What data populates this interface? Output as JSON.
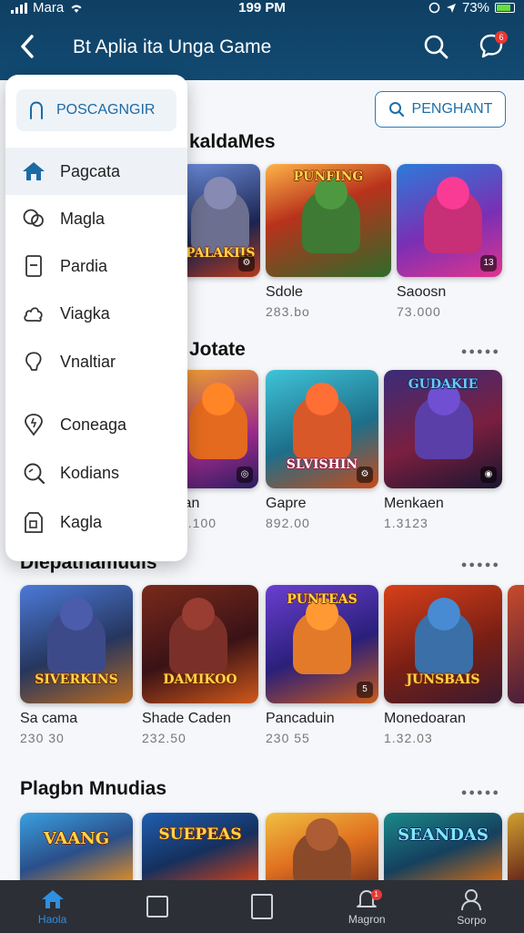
{
  "status_bar": {
    "carrier": "Mara",
    "time": "199 PM",
    "battery": "73%"
  },
  "header": {
    "title": "Bt  Aplia ita Unga Game",
    "notification_count": "6"
  },
  "main": {
    "primary_button": "PENGHANT"
  },
  "sections": [
    {
      "title": "kaldaMes",
      "cards": [
        {
          "name": "",
          "meta": "",
          "logo": "PALAKIIS",
          "corner": ""
        },
        {
          "name": "",
          "meta": "",
          "logo": "PUNFING",
          "corner": ""
        },
        {
          "name": "Sdole",
          "meta": "283.bo",
          "logo": "",
          "corner": ""
        },
        {
          "name": "Saoosn",
          "meta": "73.000",
          "logo": "",
          "corner": "13"
        }
      ]
    },
    {
      "title": "Jotate",
      "cards": [
        {
          "name": "ian",
          "meta": "3.100",
          "logo": "",
          "corner": ""
        },
        {
          "name": "Gapre",
          "meta": "892.00",
          "logo": "SLVISHIN",
          "corner": ""
        },
        {
          "name": "Menkaen",
          "meta": "1.3123",
          "logo": "GUDAKIE",
          "corner": ""
        }
      ]
    },
    {
      "title": "Diepatnamuuis",
      "cards": [
        {
          "name": "Sa cama",
          "meta": "230 30",
          "logo": "SIVERKINS",
          "corner": ""
        },
        {
          "name": "Shade Caden",
          "meta": "232.50",
          "logo": "DAMIKOO",
          "corner": ""
        },
        {
          "name": "Pancaduin",
          "meta": "230 55",
          "logo": "PUNTEAS",
          "corner": "5"
        },
        {
          "name": "Monedoaran",
          "meta": "1.32.03",
          "logo": "JUNSBAIS",
          "corner": ""
        }
      ]
    },
    {
      "title": "Plagbn Mnudias",
      "cards": [
        {
          "name": "",
          "meta": "",
          "logo": "VAANG",
          "corner": ""
        },
        {
          "name": "",
          "meta": "",
          "logo": "SUEPEAS",
          "corner": ""
        },
        {
          "name": "",
          "meta": "",
          "logo": "",
          "corner": ""
        },
        {
          "name": "",
          "meta": "",
          "logo": "SEANDAS",
          "corner": ""
        }
      ]
    }
  ],
  "drawer": {
    "header_label": "POSCAGNGIR",
    "items": [
      {
        "label": "Pagcata",
        "icon": "home-icon"
      },
      {
        "label": "Magla",
        "icon": "chat-icon"
      },
      {
        "label": "Pardia",
        "icon": "document-icon"
      },
      {
        "label": "Viagka",
        "icon": "cloud-icon"
      },
      {
        "label": "Vnaltiar",
        "icon": "bulb-icon"
      },
      {
        "label": "Coneaga",
        "icon": "location-icon"
      },
      {
        "label": "Kodians",
        "icon": "search-icon"
      },
      {
        "label": "Kagla",
        "icon": "shop-icon"
      }
    ]
  },
  "bottom_nav": [
    {
      "label": "Haola"
    },
    {
      "label": ""
    },
    {
      "label": ""
    },
    {
      "label": "Magron",
      "badge": "1"
    },
    {
      "label": "Sorpo"
    }
  ],
  "colors": {
    "header": "#124a72",
    "accent": "#2b7bb5",
    "nav_bg": "#2c2f36",
    "nav_active": "#2f8fe0",
    "badge": "#e53935"
  }
}
